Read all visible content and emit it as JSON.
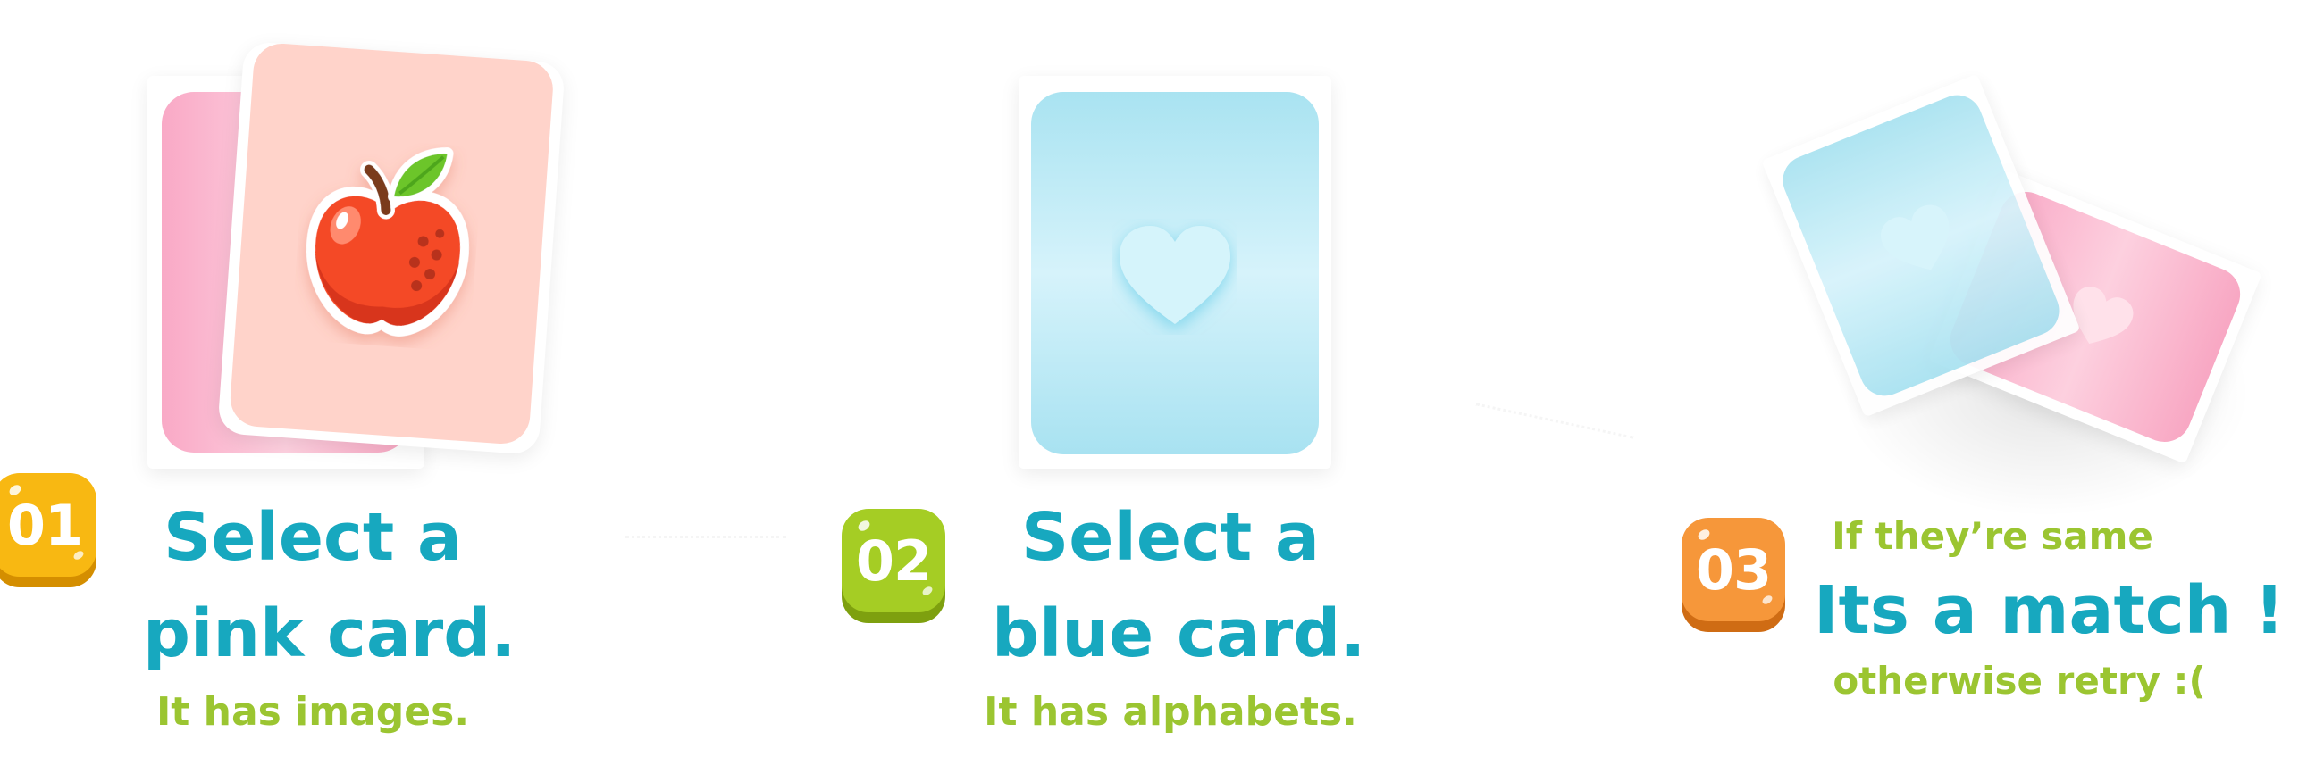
{
  "steps": [
    {
      "number": "01",
      "title_line1": "Select a",
      "title_line2": "pink card.",
      "subtitle": "It has images.",
      "card_icon": "apple-icon"
    },
    {
      "number": "02",
      "title_line1": "Select a",
      "title_line2": "blue card.",
      "subtitle": "It has alphabets.",
      "card_icon": "heart-icon"
    },
    {
      "number": "03",
      "intro": "If they’re same",
      "title": "Its a match !",
      "subtitle": "otherwise retry :(",
      "card_icon": "heart-icon"
    }
  ],
  "colors": {
    "title": "#17a8bf",
    "subtitle": "#9bc531",
    "badge_1": "#f8b812",
    "badge_2": "#a5cd24",
    "badge_3": "#f6973a",
    "pink_card": "#f9a9c6",
    "peach_card": "#ffd3ca",
    "blue_card": "#a9e3f1"
  }
}
